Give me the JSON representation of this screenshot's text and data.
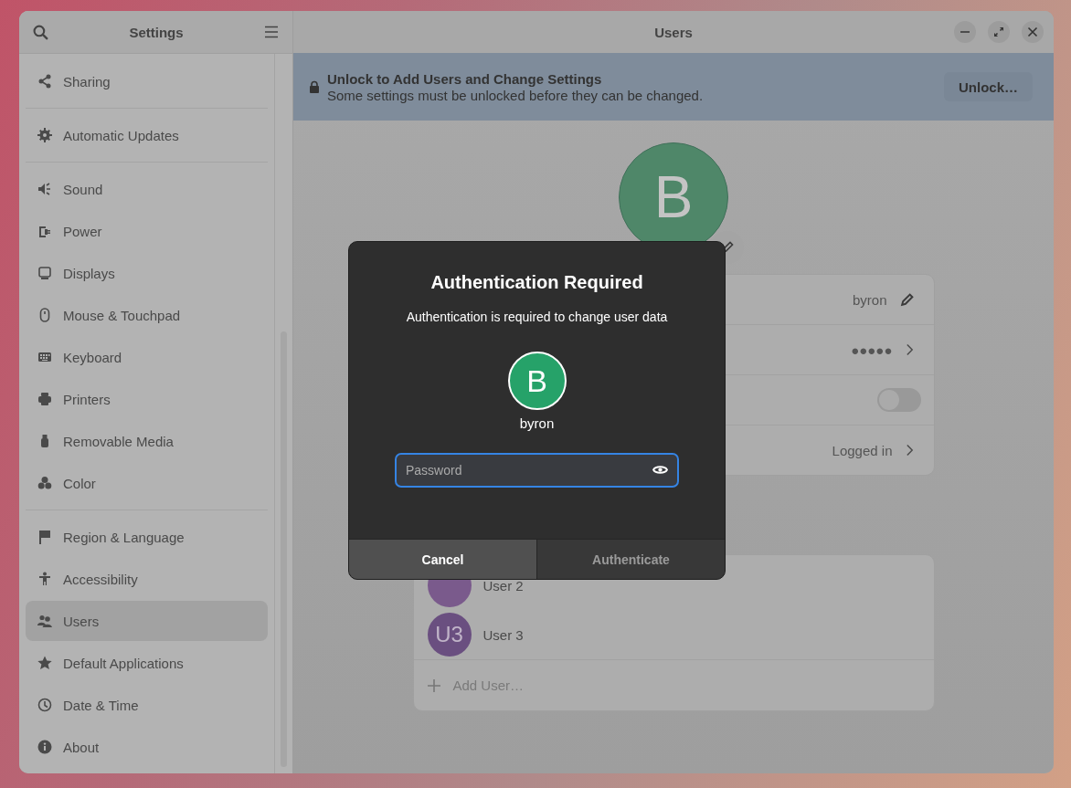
{
  "sidebar": {
    "title": "Settings",
    "groups": [
      [
        {
          "label": "Sharing",
          "selected": false
        }
      ],
      [
        {
          "label": "Automatic Updates",
          "selected": false
        }
      ],
      [
        {
          "label": "Sound",
          "selected": false
        },
        {
          "label": "Power",
          "selected": false
        },
        {
          "label": "Displays",
          "selected": false
        },
        {
          "label": "Mouse & Touchpad",
          "selected": false
        },
        {
          "label": "Keyboard",
          "selected": false
        },
        {
          "label": "Printers",
          "selected": false
        },
        {
          "label": "Removable Media",
          "selected": false
        },
        {
          "label": "Color",
          "selected": false
        }
      ],
      [
        {
          "label": "Region & Language",
          "selected": false
        },
        {
          "label": "Accessibility",
          "selected": false
        },
        {
          "label": "Users",
          "selected": true
        },
        {
          "label": "Default Applications",
          "selected": false
        },
        {
          "label": "Date & Time",
          "selected": false
        },
        {
          "label": "About",
          "selected": false
        }
      ]
    ]
  },
  "window": {
    "title": "Users"
  },
  "banner": {
    "title": "Unlock to Add Users and Change Settings",
    "message": "Some settings must be unlocked before they can be changed.",
    "button": "Unlock…"
  },
  "profile": {
    "initial": "B",
    "rows": [
      {
        "kind": "edit",
        "value": "byron"
      },
      {
        "kind": "link",
        "value": "●●●●●"
      },
      {
        "kind": "switch",
        "on": false
      },
      {
        "kind": "link",
        "value": "Logged in"
      }
    ]
  },
  "other_users": [
    {
      "name": "User 2",
      "color": "#7a5a8c"
    },
    {
      "initials": "U3",
      "name": "User 3",
      "color": "#6a4f80"
    }
  ],
  "add_user": "Add User…",
  "dialog": {
    "title": "Authentication Required",
    "message": "Authentication is required to change user data",
    "initial": "B",
    "username": "byron",
    "placeholder": "Password",
    "buttons": [
      {
        "label": "Cancel",
        "disabled": false
      },
      {
        "label": "Authenticate",
        "disabled": true
      }
    ]
  }
}
